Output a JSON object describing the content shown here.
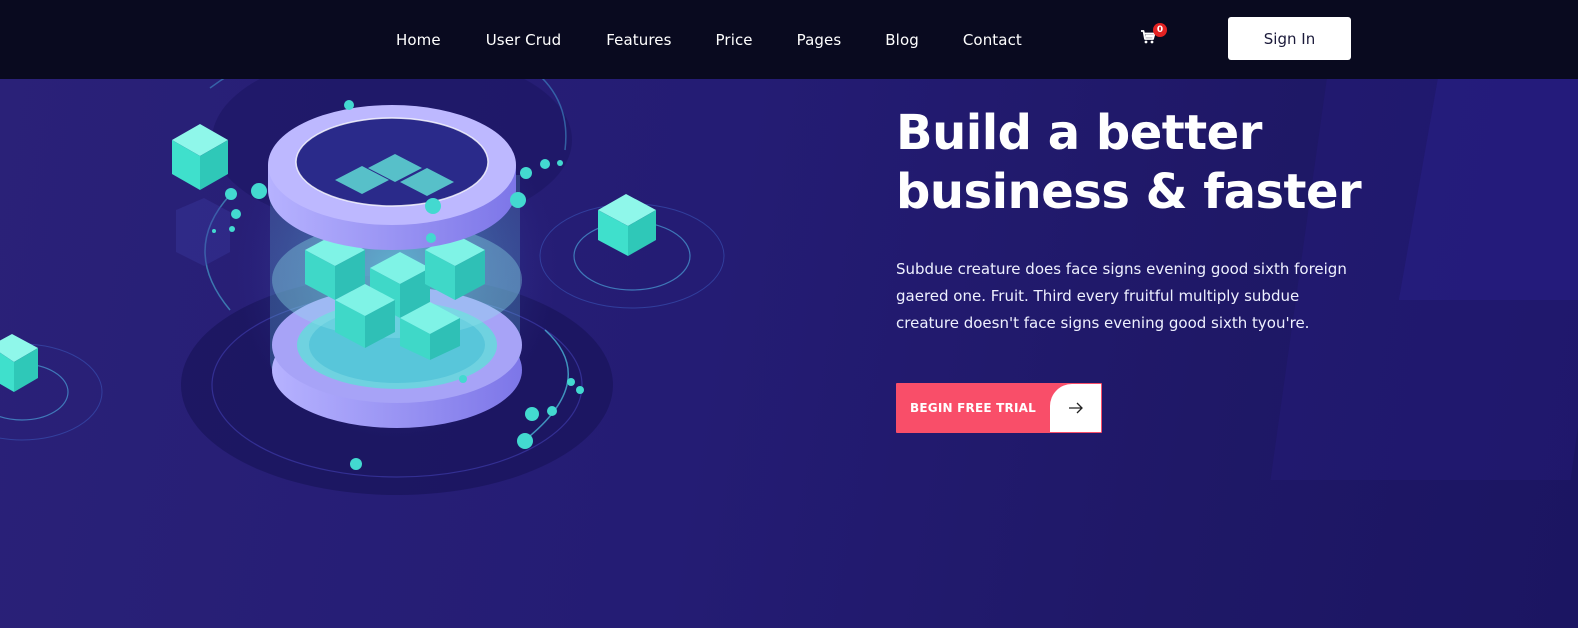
{
  "nav": {
    "items": [
      {
        "label": "Home"
      },
      {
        "label": "User Crud"
      },
      {
        "label": "Features"
      },
      {
        "label": "Price"
      },
      {
        "label": "Pages"
      },
      {
        "label": "Blog"
      },
      {
        "label": "Contact"
      }
    ],
    "cart_count": "0",
    "cart_icon": "cart-icon",
    "signin_label": "Sign In"
  },
  "hero": {
    "title_line1": "Build a better",
    "title_line2": "business & faster",
    "description": "Subdue creature does face signs evening good sixth foreign gaered one. Fruit. Third every fruitful multiply subdue creature doesn't face signs evening good sixth tyou're.",
    "cta_label": "BEGIN FREE TRIAL",
    "cta_icon": "arrow-right-icon"
  },
  "colors": {
    "nav_bg": "#090a1f",
    "hero_bg": "#241d72",
    "accent": "#f94e69",
    "cube": "#40e0d0"
  }
}
